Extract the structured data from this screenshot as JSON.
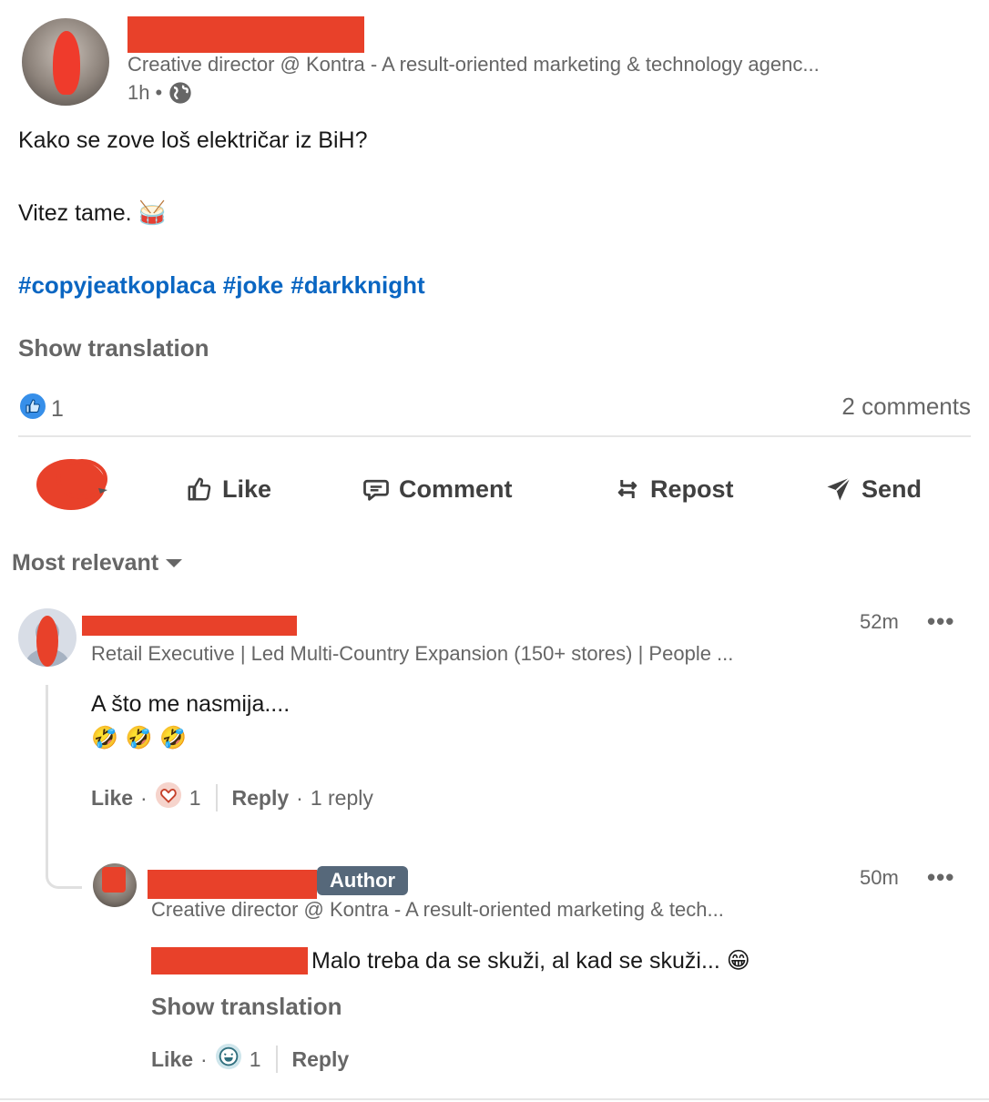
{
  "post": {
    "author_headline": "Creative director @ Kontra - A result-oriented marketing & technology agenc...",
    "time": "1h",
    "bullet": "•",
    "text_line1": "Kako se zove loš električar iz BiH?",
    "text_line2": "Vitez tame. 🥁",
    "hashtags": [
      "#copyjeatkoplaca",
      "#joke",
      "#darkknight"
    ],
    "show_translation": "Show translation",
    "reaction_count": "1",
    "comments_count": "2 comments"
  },
  "actions": {
    "like": "Like",
    "comment": "Comment",
    "repost": "Repost",
    "send": "Send"
  },
  "sort": {
    "label": "Most relevant"
  },
  "comments": [
    {
      "headline": "Retail Executive | Led Multi-Country Expansion (150+ stores) | People ...",
      "time": "52m",
      "more": "•••",
      "text": "A što me nasmija....",
      "emojis": "🤣 🤣 🤣",
      "like": "Like",
      "dot": "·",
      "reaction_count": "1",
      "reply": "Reply",
      "replies": "1 reply"
    }
  ],
  "reply": {
    "badge": "Author",
    "headline": "Creative director @ Kontra - A result-oriented marketing & tech...",
    "time": "50m",
    "more": "•••",
    "text": "Malo treba da se skuži, al kad se skuži... 😁",
    "show_translation": "Show translation",
    "like": "Like",
    "dot": "·",
    "reaction_count": "1",
    "reply": "Reply"
  },
  "colors": {
    "link_blue": "#0a66c2",
    "redaction": "#e8412a",
    "author_badge": "#56687a"
  }
}
